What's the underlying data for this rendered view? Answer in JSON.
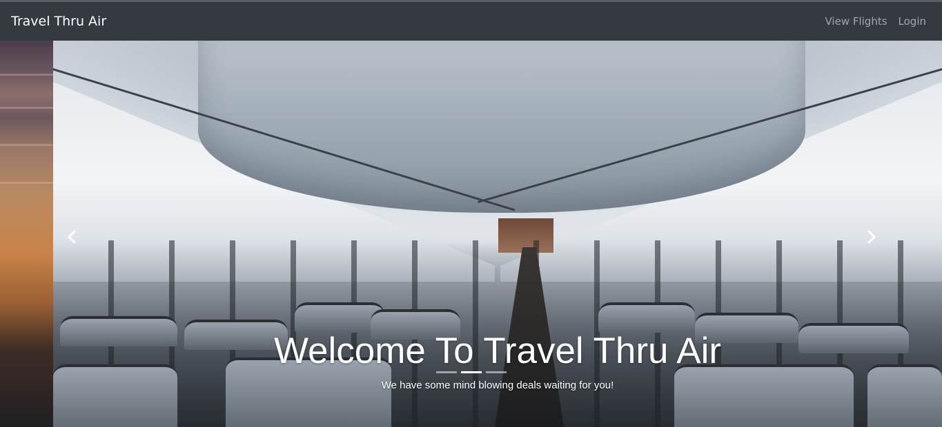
{
  "navbar": {
    "brand": "Travel Thru Air",
    "links": [
      {
        "label": "View Flights"
      },
      {
        "label": "Login"
      }
    ]
  },
  "carousel": {
    "caption": {
      "title_prefix": "Welcome To",
      "title_brand": "Travel Thru Air",
      "subtitle": "We have some mind blowing deals waiting for you!"
    },
    "active_slide": 2,
    "slide_count": 3,
    "icons": {
      "prev": "chevron-left-icon",
      "next": "chevron-right-icon"
    }
  }
}
